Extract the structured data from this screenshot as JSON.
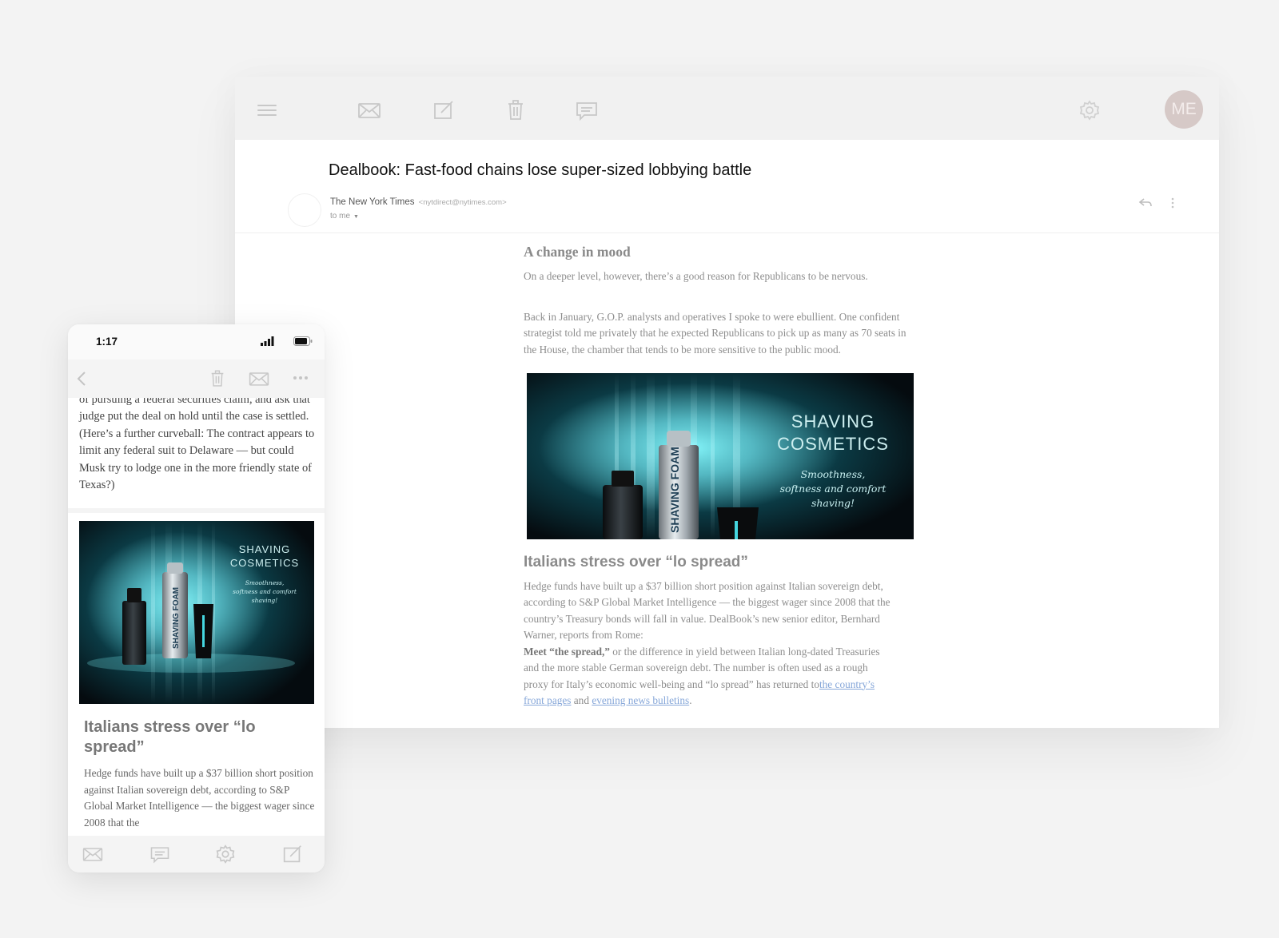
{
  "desktop": {
    "toolbar": {
      "icons": [
        "menu-icon",
        "mail-icon",
        "compose-icon",
        "trash-icon",
        "chat-icon",
        "gear-icon"
      ],
      "avatar_initials": "ME"
    },
    "email": {
      "subject": "Dealbook: Fast-food chains lose super-sized lobbying battle",
      "sender_name": "The New York Times",
      "sender_email": "<nytdirect@nytimes.com>",
      "to": "to me"
    },
    "article": {
      "heading1": "A change in mood",
      "para1": "On a deeper level, however, there’s a good reason for Republicans to be nervous.",
      "para2": "Back in January, G.O.P. analysts and operatives I spoke to were ebullient. One confident strategist told me privately that he expected Republicans to pick up as many as 70 seats in the House, the chamber that tends to be more sensitive to the public mood.",
      "promo": {
        "title_line1": "SHAVING",
        "title_line2": "COSMETICS",
        "tagline1": "Smoothness,",
        "tagline2": "softness and comfort",
        "tagline3": "shaving!",
        "can_label": "SHAVING FOAM"
      },
      "heading2": "Italians stress over “lo spread”",
      "para3": "Hedge funds have built up a $37 billion short position against Italian sovereign debt, according to S&P Global Market Intelligence — the biggest wager since 2008 that the country’s Treasury bonds will fall in value. DealBook’s new senior editor, Bernhard Warner, reports from Rome:",
      "para4_bold": "Meet “the spread,”",
      "para4_text": " or the difference in yield between Italian long-dated Treasuries and the more stable German sovereign debt. The number is often used as a rough proxy for Italy’s economic well-being and “lo spread” has returned to",
      "link1": "the country’s front pages",
      "para4_and": " and ",
      "link2": "evening news bulletins",
      "para4_end": "."
    }
  },
  "phone": {
    "status_time": "1:17",
    "toolbar_icons": [
      "back-icon",
      "trash-icon",
      "mail-icon",
      "more-icon"
    ],
    "text_top": "of pursuing a federal securities claim, and ask that judge put the deal on hold until the case is settled. (Here’s a further curveball: The contract appears to limit any federal suit to Delaware — but could Musk try to lodge one in the more friendly state of Texas?)",
    "heading": "Italians stress over “lo spread”",
    "para": "Hedge funds have built up a $37 billion short position against Italian sovereign debt, according to S&P Global Market Intelligence — the biggest wager since 2008 that the",
    "tabbar_icons": [
      "mail-icon",
      "chat-icon",
      "gear-icon",
      "compose-icon"
    ]
  },
  "colors": {
    "background": "#f3f3f3",
    "avatar": "#d6c9c7",
    "link": "#86a7d9",
    "promo_glow": "#5fe3ea"
  }
}
